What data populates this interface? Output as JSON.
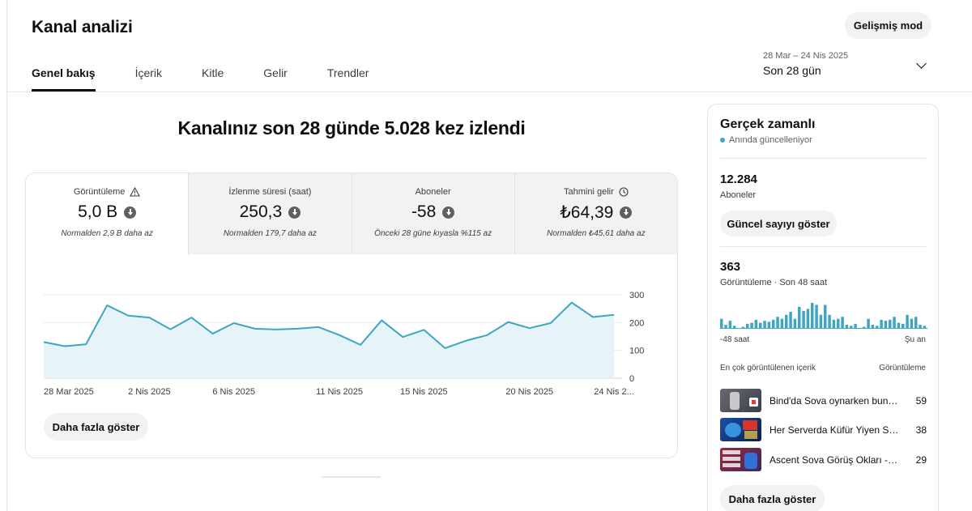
{
  "page": {
    "title": "Kanal analizi",
    "advanced_mode_label": "Gelişmiş mod",
    "headline": "Kanalınız son 28 günde 5.028 kez izlendi"
  },
  "tabs": [
    {
      "label": "Genel bakış",
      "active": true
    },
    {
      "label": "İçerik",
      "active": false
    },
    {
      "label": "Kitle",
      "active": false
    },
    {
      "label": "Gelir",
      "active": false
    },
    {
      "label": "Trendler",
      "active": false
    }
  ],
  "date_picker": {
    "range": "28 Mar – 24 Nis 2025",
    "period": "Son 28 gün",
    "icon": "chevron-down-icon"
  },
  "metrics": [
    {
      "title": "Görüntüleme",
      "value": "5,0 B",
      "sub": "Normalden 2,9 B daha az",
      "title_icon": "warning-icon",
      "trend_icon": "arrow-down-circle-icon"
    },
    {
      "title": "İzlenme süresi (saat)",
      "value": "250,3",
      "sub": "Normalden 179,7 daha az",
      "trend_icon": "arrow-down-circle-icon"
    },
    {
      "title": "Aboneler",
      "value": "-58",
      "sub": "Önceki 28 güne kıyasla %115 az",
      "trend_icon": "arrow-down-circle-icon"
    },
    {
      "title": "Tahmini gelir",
      "value": "₺64,39",
      "sub": "Normalden ₺45,61 daha az",
      "title_icon": "clock-icon",
      "trend_icon": "arrow-down-circle-icon"
    }
  ],
  "chart_data": {
    "type": "area",
    "x": [
      "28 Mar 2025",
      "29 Mar 2025",
      "30 Mar 2025",
      "31 Mar 2025",
      "1 Nis 2025",
      "2 Nis 2025",
      "3 Nis 2025",
      "4 Nis 2025",
      "5 Nis 2025",
      "6 Nis 2025",
      "7 Nis 2025",
      "8 Nis 2025",
      "9 Nis 2025",
      "10 Nis 2025",
      "11 Nis 2025",
      "12 Nis 2025",
      "13 Nis 2025",
      "14 Nis 2025",
      "15 Nis 2025",
      "16 Nis 2025",
      "17 Nis 2025",
      "18 Nis 2025",
      "19 Nis 2025",
      "20 Nis 2025",
      "21 Nis 2025",
      "22 Nis 2025",
      "23 Nis 2025",
      "24 Nis 2025"
    ],
    "tick_labels": [
      "28 Mar 2025",
      "2 Nis 2025",
      "6 Nis 2025",
      "11 Nis 2025",
      "15 Nis 2025",
      "20 Nis 2025",
      "24 Nis 2..."
    ],
    "tick_indices": [
      0,
      5,
      9,
      14,
      18,
      23,
      27
    ],
    "series": [
      {
        "values": [
          130,
          115,
          122,
          262,
          225,
          218,
          176,
          218,
          160,
          198,
          178,
          175,
          178,
          184,
          155,
          120,
          208,
          148,
          174,
          108,
          135,
          155,
          202,
          180,
          198,
          272,
          220,
          228
        ],
        "color": "#3ea6c2"
      }
    ],
    "ylim": [
      0,
      300
    ],
    "yticks": [
      0,
      100,
      200,
      300
    ],
    "area_fill": "#e6f4f9",
    "grid": true
  },
  "chart_more_label": "Daha fazla göster",
  "realtime": {
    "title": "Gerçek zamanlı",
    "live_label": "Anında güncelleniyor",
    "live_color": "#3ea6c2",
    "subscribers_value": "12.284",
    "subscribers_label": "Aboneler",
    "show_count_label": "Güncel sayıyı göster",
    "views_value": "363",
    "views_label": "Görüntüleme · Son 48 saat",
    "axis_left": "-48 saat",
    "axis_right": "Şu an",
    "bars_48h": [
      10,
      4,
      8,
      3,
      0,
      2,
      5,
      6,
      9,
      6,
      8,
      7,
      9,
      12,
      10,
      14,
      17,
      10,
      22,
      18,
      20,
      26,
      24,
      14,
      24,
      14,
      9,
      10,
      12,
      4,
      3,
      5,
      0,
      2,
      10,
      4,
      3,
      9,
      8,
      9,
      12,
      6,
      5,
      14,
      10,
      12,
      4,
      3
    ],
    "top_content_label": "En çok görüntülenen içerik",
    "top_views_label": "Görüntüleme",
    "top_videos": [
      {
        "title": "Bind'da Sova oynarken bunu ...",
        "views": "59"
      },
      {
        "title": "Her Serverda Küfür Yiyen So...",
        "views": "38"
      },
      {
        "title": "Ascent Sova Görüş Okları - V...",
        "views": "29"
      }
    ],
    "more_label": "Daha fazla göster"
  }
}
